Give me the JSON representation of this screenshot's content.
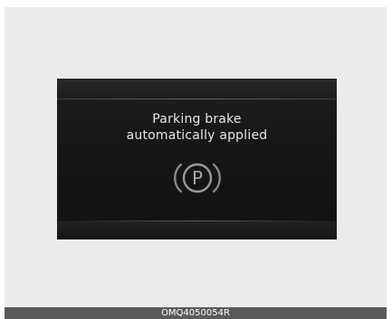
{
  "display": {
    "message_line1": "Parking brake",
    "message_line2": "automatically applied",
    "icon": "parking-brake-icon",
    "icon_letter": "P"
  },
  "caption": "OMQ4050054R",
  "colors": {
    "display_bg": "#161616",
    "text": "#e6e6e6",
    "icon_gray": "#9a9a9a",
    "caption_bar": "#5a5a5a"
  }
}
